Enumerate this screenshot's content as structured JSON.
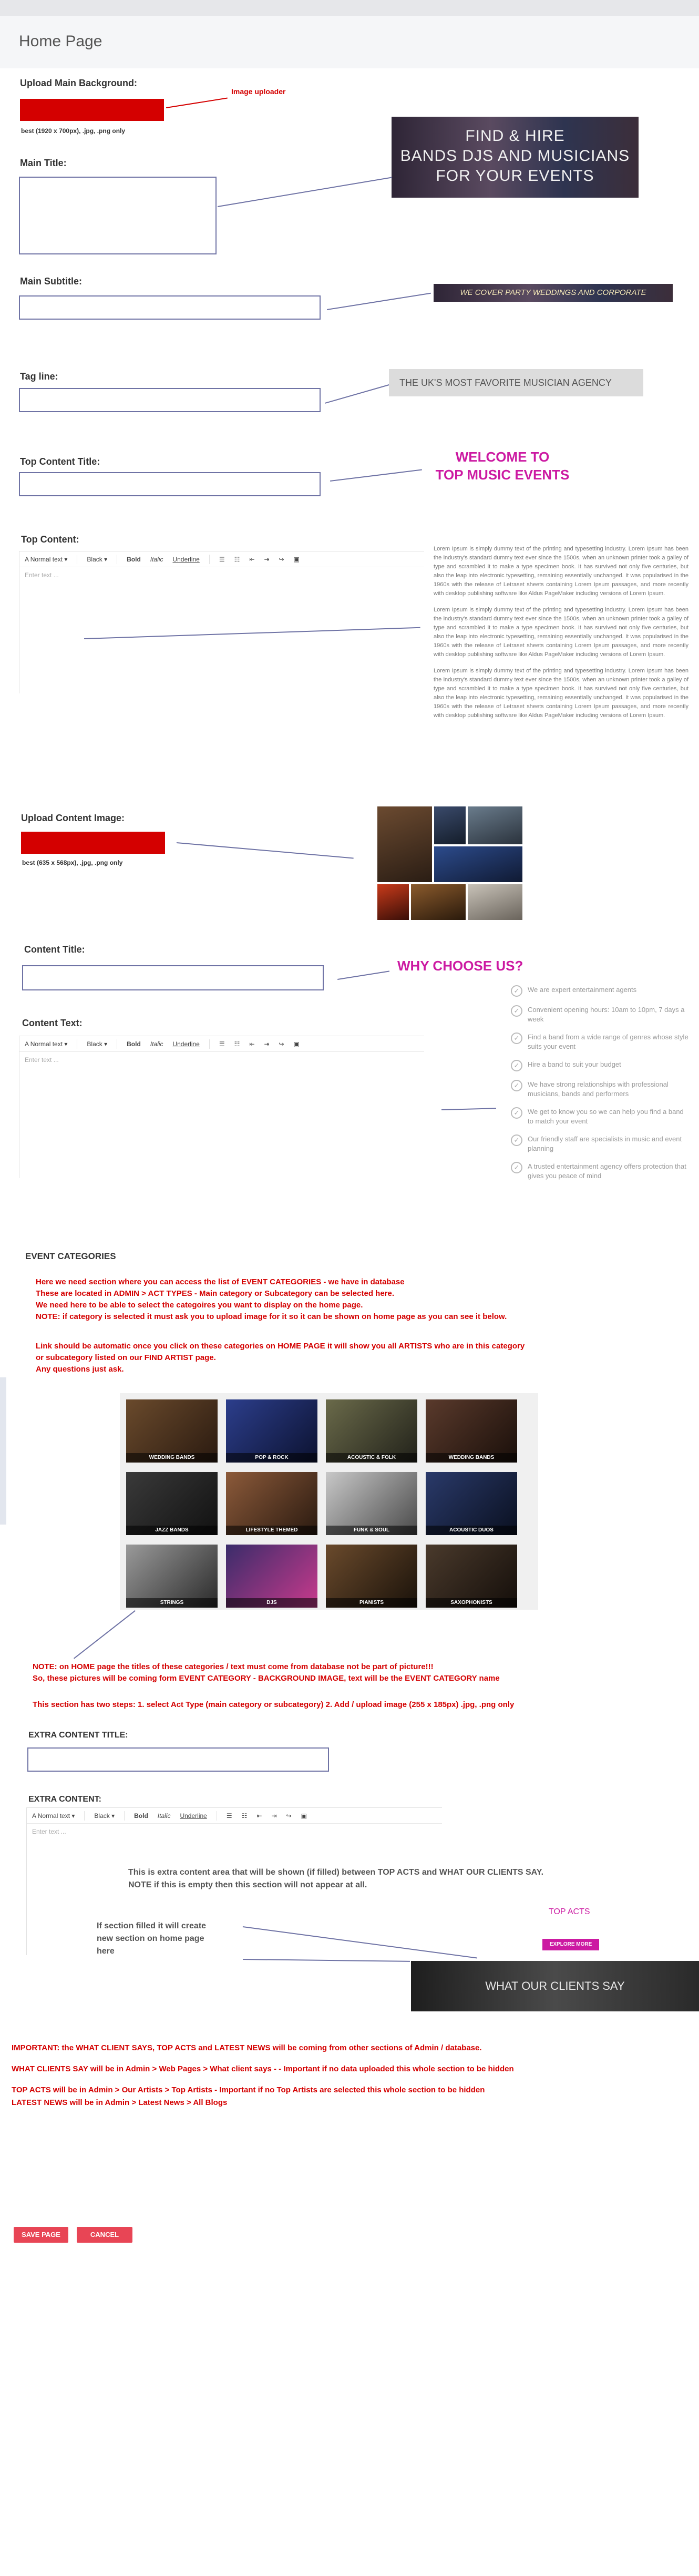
{
  "page": {
    "title": "Home Page"
  },
  "upload_background": {
    "label": "Upload Main Background:",
    "hint": "best (1920 x 700px), .jpg, .png  only",
    "annotation": "Image uploader",
    "preview_text": "FIND & HIRE\nBANDS DJS AND MUSICIANS\nFOR YOUR EVENTS"
  },
  "main_title": {
    "label": "Main Title:",
    "value": ""
  },
  "main_subtitle": {
    "label": "Main Subtitle:",
    "value": "",
    "preview_text": "WE COVER PARTY WEDDINGS AND CORPORATE"
  },
  "tag_line": {
    "label": "Tag line:",
    "value": "",
    "preview_text": "THE UK'S MOST FAVORITE MUSICIAN AGENCY"
  },
  "top_content_title": {
    "label": "Top Content Title:",
    "value": "",
    "preview_text": "WELCOME TO\nTOP MUSIC EVENTS"
  },
  "top_content": {
    "label": "Top Content:",
    "placeholder": "Enter text ...",
    "lorem": [
      "Lorem Ipsum is simply dummy text of the printing and typesetting industry. Lorem Ipsum has been the industry's standard dummy text ever since the 1500s, when an unknown printer took a galley of type and scrambled it to make a type specimen book. It has survived not only five centuries, but also the leap into electronic typesetting, remaining essentially unchanged. It was popularised in the 1960s with the release of Letraset sheets containing Lorem Ipsum passages, and more recently with desktop publishing software like Aldus PageMaker including versions of Lorem Ipsum.",
      "Lorem Ipsum is simply dummy text of the printing and typesetting industry. Lorem Ipsum has been the industry's standard dummy text ever since the 1500s, when an unknown printer took a galley of type and scrambled it to make a type specimen book. It has survived not only five centuries, but also the leap into electronic typesetting, remaining essentially unchanged. It was popularised in the 1960s with the release of Letraset sheets containing Lorem Ipsum passages, and more recently with desktop publishing software like Aldus PageMaker including versions of Lorem Ipsum.",
      "Lorem Ipsum is simply dummy text of the printing and typesetting industry. Lorem Ipsum has been the industry's standard dummy text ever since the 1500s, when an unknown printer took a galley of type and scrambled it to make a type specimen book. It has survived not only five centuries, but also the leap into electronic typesetting, remaining essentially unchanged. It was popularised in the 1960s with the release of Letraset sheets containing Lorem Ipsum passages, and more recently with desktop publishing software like Aldus PageMaker including versions of Lorem Ipsum."
    ]
  },
  "toolbar": {
    "font_size": "Normal text",
    "color": "Black",
    "bold": "Bold",
    "italic": "Italic",
    "underline": "Underline"
  },
  "upload_content_image": {
    "label": "Upload Content Image:",
    "hint": "best (635 x 568px), .jpg, .png  only"
  },
  "content_title": {
    "label": "Content Title:",
    "value": "",
    "preview_text": "WHY CHOOSE US?"
  },
  "content_text": {
    "label": "Content Text:",
    "placeholder": "Enter text ...",
    "checklist": [
      "We are expert entertainment agents",
      "Convenient opening hours: 10am to 10pm, 7 days a week",
      "Find a band from a wide range of genres whose style suits your event",
      "Hire a band to suit your budget",
      "We have strong relationships with professional musicians, bands and performers",
      "We get to know you so we can help you find a band to match your event",
      "Our friendly staff are specialists in music and event planning",
      "A trusted entertainment agency offers protection that gives you peace of mind"
    ]
  },
  "event_categories": {
    "heading": "EVENT CATEGORIES",
    "notes_1": [
      "Here we need section where you can access the list of EVENT CATEGORIES - we have in database",
      "These are located in ADMIN > ACT TYPES - Main category or Subcategory can be selected here.",
      "We need here to be able to select the categoires you want to display on the home page.",
      "NOTE: if category is selected it must ask you to upload image for it so it can be shown on home page as you can see it below."
    ],
    "notes_2": [
      "Link should be automatic once you click on these categories on HOME PAGE it will show you all ARTISTS who are in this category",
      "or subcategory listed on our FIND ARTIST page.",
      "Any questions just ask."
    ],
    "tiles": [
      "WEDDING BANDS",
      "POP & ROCK",
      "ACOUSTIC & FOLK",
      "WEDDING BANDS",
      "JAZZ BANDS",
      "LIFESTYLE THEMED",
      "FUNK & SOUL",
      "ACOUSTIC DUOS",
      "STRINGS",
      "DJS",
      "PIANISTS",
      "SAXOPHONISTS"
    ],
    "notes_3": [
      "NOTE: on HOME page the titles of these categories / text must come from database not be part of picture!!!",
      "So, these pictures will be coming form EVENT CATEGORY - BACKGROUND IMAGE, text will be the EVENT CATEGORY name"
    ],
    "steps": "This section has two steps:  1. select Act Type (main category or subcategory)       2. Add / upload image (255 x 185px)  .jpg, .png only"
  },
  "extra_content_title": {
    "label": "EXTRA CONTENT TITLE:",
    "value": ""
  },
  "extra_content": {
    "label": "EXTRA CONTENT:",
    "placeholder": "Enter text ...",
    "note": "This is extra content area that will be shown (if filled) between TOP ACTS and WHAT OUR CLIENTS SAY.\nNOTE if this is empty then this section will not appear at all.",
    "section_note": "If section filled it will create\nnew section on home page\nhere",
    "top_acts": "TOP ACTS",
    "explore_more": "EXPLORE MORE",
    "clients_say": "WHAT OUR CLIENTS SAY"
  },
  "important": [
    "IMPORTANT:  the  WHAT CLIENT SAYS,  TOP ACTS and LATEST NEWS will be coming from other sections of Admin / database.",
    "WHAT CLIENTS SAY will be in  Admin > Web Pages >  What client says - - Important if no data uploaded this whole section to be hidden",
    "TOP ACTS will be in  Admin > Our Artists > Top Artists   - Important if no Top Artists are selected this whole section to be hidden",
    "LATEST NEWS will be in Admin > Latest News > All Blogs"
  ],
  "actions": {
    "save": "SAVE PAGE",
    "cancel": "CANCEL"
  },
  "colors": {
    "accent_red": "#d40000",
    "magenta": "#cc1aa2",
    "input_border": "#6f73a5",
    "button_red": "#e84555"
  }
}
